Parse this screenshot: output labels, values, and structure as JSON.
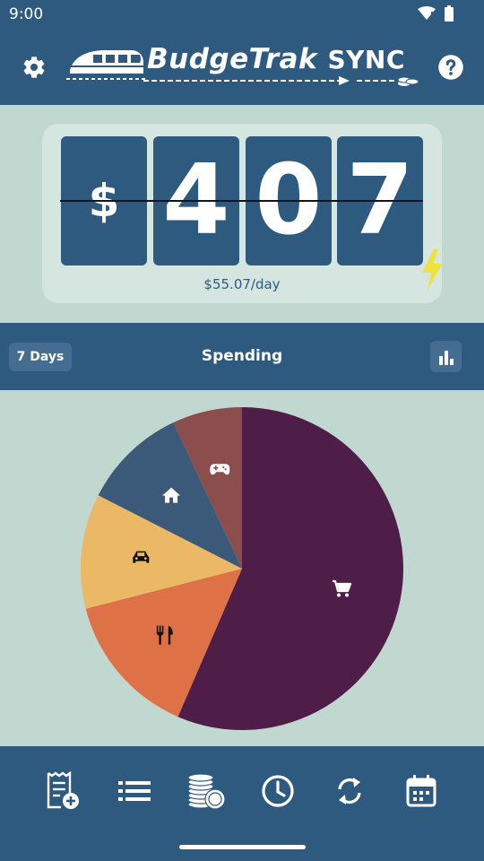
{
  "status_bar": {
    "time": "9:00"
  },
  "app_bar": {
    "settings_icon": "gear-icon",
    "help_icon": "help-circle-icon",
    "logo_text": "BudgeTrak",
    "logo_sync": "SYNC"
  },
  "counter": {
    "currency": "$",
    "digits": [
      "4",
      "0",
      "7"
    ],
    "per_day": "$55.07/day",
    "bolt_icon": "lightning-icon"
  },
  "spending_header": {
    "range_button": "7 Days",
    "title": "Spending",
    "chart_icon": "bar-chart-icon"
  },
  "chart_data": {
    "type": "pie",
    "slices": [
      {
        "icon": "shopping-cart-icon",
        "value": 56.5,
        "color": "#4e1e48"
      },
      {
        "icon": "restaurant-icon",
        "value": 14.5,
        "color": "#df7147"
      },
      {
        "icon": "car-icon",
        "value": 11.5,
        "color": "#ebb866"
      },
      {
        "icon": "home-icon",
        "value": 10.5,
        "color": "#3b5a79"
      },
      {
        "icon": "gamepad-icon",
        "value": 7.0,
        "color": "#8b4e4c"
      }
    ]
  },
  "bottom_nav": [
    {
      "icon": "add-receipt-icon"
    },
    {
      "icon": "list-icon"
    },
    {
      "icon": "coins-icon"
    },
    {
      "icon": "clock-icon"
    },
    {
      "icon": "sync-icon"
    },
    {
      "icon": "calendar-icon"
    }
  ],
  "colors": {
    "primary": "#2e5a80",
    "background": "#c0d8d0",
    "card": "#d5e5e0",
    "accent_bolt": "#f2e13a"
  }
}
